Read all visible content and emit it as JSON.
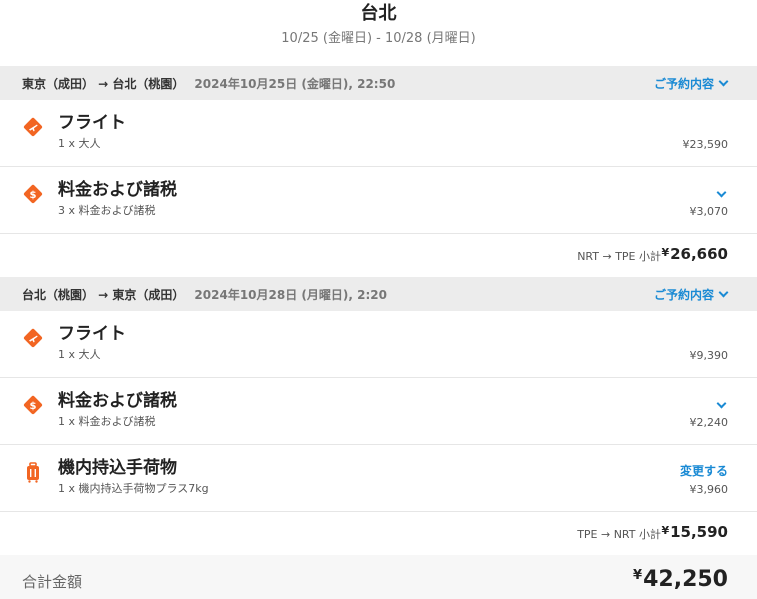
{
  "header": {
    "title": "台北",
    "dates": "10/25 (金曜日) - 10/28 (月曜日)"
  },
  "legs": [
    {
      "route": "東京（成田） → 台北（桃園）",
      "datetime": "2024年10月25日 (金曜日), 22:50",
      "details_label": "ご予約内容",
      "items": [
        {
          "name": "フライト",
          "desc": "1 x 大人",
          "price": "¥23,590",
          "icon": "flight-tag-icon"
        },
        {
          "name": "料金および諸税",
          "desc": "3 x 料金および諸税",
          "price": "¥3,070",
          "icon": "fee-tag-icon"
        }
      ],
      "subtotal_label": "NRT → TPE 小計",
      "subtotal_yen": "¥",
      "subtotal_value": "26,660"
    },
    {
      "route": "台北（桃園） → 東京（成田）",
      "datetime": "2024年10月28日 (月曜日), 2:20",
      "details_label": "ご予約内容",
      "items": [
        {
          "name": "フライト",
          "desc": "1 x 大人",
          "price": "¥9,390",
          "icon": "flight-tag-icon"
        },
        {
          "name": "料金および諸税",
          "desc": "1 x 料金および諸税",
          "price": "¥2,240",
          "icon": "fee-tag-icon"
        },
        {
          "name": "機内持込手荷物",
          "desc": "1 x 機内持込手荷物プラス7kg",
          "price": "¥3,960",
          "icon": "luggage-icon",
          "action_label": "変更する"
        }
      ],
      "subtotal_label": "TPE → NRT 小計",
      "subtotal_yen": "¥",
      "subtotal_value": "15,590"
    }
  ],
  "total": {
    "label": "合計金額",
    "yen": "¥",
    "value": "42,250"
  },
  "colors": {
    "accent": "#f26522",
    "link": "#1a8ad4",
    "bar_bg": "#ececec"
  }
}
